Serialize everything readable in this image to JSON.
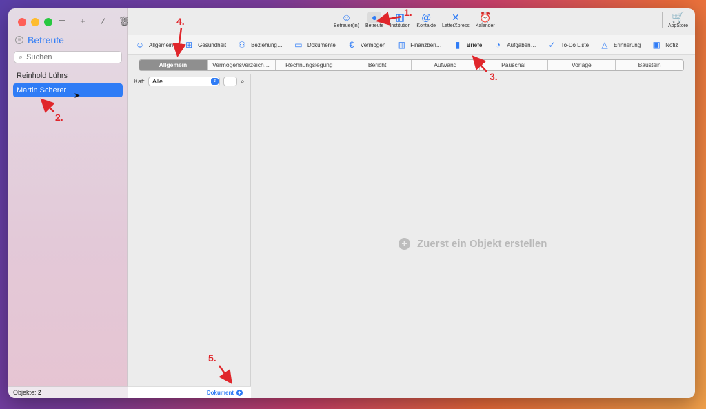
{
  "sidebar": {
    "title": "Betreute",
    "search_placeholder": "Suchen",
    "items": [
      {
        "label": "Reinhold Lührs",
        "selected": false
      },
      {
        "label": "Martin Scherer",
        "selected": true
      }
    ],
    "footer_label": "Objekte:",
    "footer_count": "2",
    "tools": [
      "sidebar-toggle-icon",
      "plus-icon",
      "pencil-icon",
      "trash-icon"
    ]
  },
  "toolbar": {
    "buttons": [
      {
        "label": "Betreuer(in)",
        "icon": "person-outline-icon",
        "active": false
      },
      {
        "label": "Betreute",
        "icon": "person-filled-icon",
        "active": true
      },
      {
        "label": "Institution",
        "icon": "building-icon",
        "active": false
      },
      {
        "label": "Kontakte",
        "icon": "at-contact-icon",
        "active": false
      },
      {
        "label": "LetterXpress",
        "icon": "letterxpress-icon",
        "active": false
      },
      {
        "label": "Kalender",
        "icon": "alarm-clock-icon",
        "active": false
      }
    ],
    "appstore_label": "AppStore"
  },
  "modules": [
    {
      "label": "Allgemein",
      "icon": "person-icon",
      "active": false
    },
    {
      "label": "Gesundheit",
      "icon": "medical-kit-icon",
      "active": false
    },
    {
      "label": "Beziehung…",
      "icon": "people-icon",
      "active": false
    },
    {
      "label": "Dokumente",
      "icon": "folder-icon",
      "active": false
    },
    {
      "label": "Vermögen",
      "icon": "euro-icon",
      "active": false
    },
    {
      "label": "Finanzberi…",
      "icon": "chart-icon",
      "active": false
    },
    {
      "label": "Briefe",
      "icon": "document-icon",
      "active": true
    },
    {
      "label": "Aufgaben…",
      "icon": "task-clock-icon",
      "active": false
    },
    {
      "label": "To-Do Liste",
      "icon": "checkmark-icon",
      "active": false
    },
    {
      "label": "Erinnerung",
      "icon": "bell-icon",
      "active": false
    },
    {
      "label": "Notiz",
      "icon": "note-icon",
      "active": false
    }
  ],
  "segments": [
    {
      "label": "Allgemein",
      "active": true
    },
    {
      "label": "Vermögensverzeich…",
      "active": false
    },
    {
      "label": "Rechnungslegung",
      "active": false
    },
    {
      "label": "Bericht",
      "active": false
    },
    {
      "label": "Aufwand",
      "active": false
    },
    {
      "label": "Pauschal",
      "active": false
    },
    {
      "label": "Vorlage",
      "active": false
    },
    {
      "label": "Baustein",
      "active": false
    }
  ],
  "list": {
    "kat_label": "Kat:",
    "kat_value": "Alle",
    "more_label": "···",
    "footer_button": "Dokument"
  },
  "detail": {
    "empty_message": "Zuerst ein Objekt erstellen"
  },
  "annotations": [
    "1.",
    "2.",
    "3.",
    "4.",
    "5."
  ],
  "colors": {
    "accent": "#2f7cf6",
    "annotation": "#e0262b"
  }
}
